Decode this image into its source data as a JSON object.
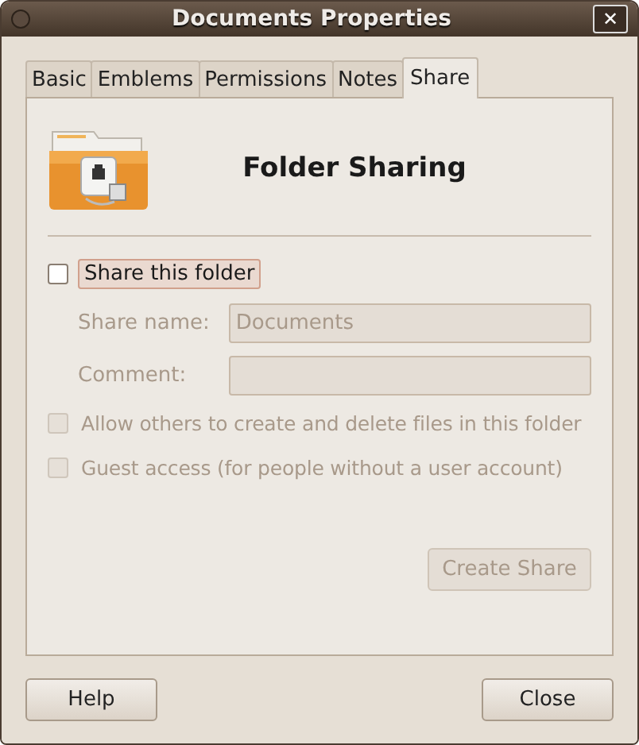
{
  "window": {
    "title": "Documents Properties",
    "close_glyph": "✕"
  },
  "tabs": [
    {
      "label": "Basic",
      "selected": false
    },
    {
      "label": "Emblems",
      "selected": false
    },
    {
      "label": "Permissions",
      "selected": false
    },
    {
      "label": "Notes",
      "selected": false
    },
    {
      "label": "Share",
      "selected": true
    }
  ],
  "heading": "Folder Sharing",
  "share_checkbox": {
    "label": "Share this folder",
    "checked": false,
    "focused": true
  },
  "fields": [
    {
      "label": "Share name:",
      "value": "Documents",
      "disabled": true
    },
    {
      "label": "Comment:",
      "disabled": true
    }
  ],
  "options": [
    {
      "label": "Allow others to create and delete files in this folder",
      "checked": false,
      "disabled": true
    },
    {
      "label": "Guest access (for people without a user account)",
      "checked": false,
      "disabled": true
    }
  ],
  "create_button": {
    "label": "Create Share",
    "disabled": true
  },
  "buttons": [
    {
      "label": "Help"
    },
    {
      "label": "Close"
    }
  ]
}
